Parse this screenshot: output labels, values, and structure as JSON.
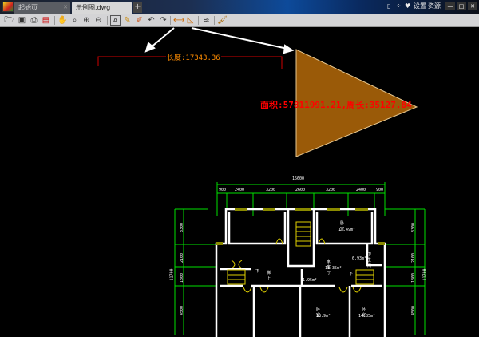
{
  "tabs": [
    {
      "label": "起始页"
    },
    {
      "label": "示例图.dwg"
    }
  ],
  "new_tab": "+",
  "title_right": {
    "settings": "设置",
    "resources": "资源"
  },
  "window_controls": {
    "minimize": "—",
    "maximize": "□",
    "close": "✕"
  },
  "toolbar": [
    "open",
    "save",
    "print",
    "export-pdf",
    "pan",
    "zoom-window",
    "zoom-in",
    "zoom-out",
    "text",
    "pencil",
    "markup",
    "undo",
    "redo",
    "measure-length",
    "measure-area",
    "layers",
    "paint"
  ],
  "measurements": {
    "length": "长度:17343.36",
    "area": "面积:57811991.21,周长:35127.84"
  },
  "colors": {
    "area_fill": "#9a5a08",
    "measure_red": "#d00000",
    "label_orange": "#ff8c00",
    "dim_green": "#00e000"
  },
  "plan": {
    "total_width": "15600",
    "top_dims": [
      "900",
      "2400",
      "3200",
      "2600",
      "3200",
      "2400",
      "900"
    ],
    "side_dims": [
      "3300",
      "2100",
      "1800",
      "4500"
    ],
    "total_height": "11700",
    "rooms": [
      {
        "name": "卧室",
        "area": "17.49m²"
      },
      {
        "name": "卫生间",
        "area": "6.93m²"
      },
      {
        "name": "家庭厅",
        "area": "11.35m²"
      },
      {
        "name": "卧室",
        "area": "18.9m²"
      },
      {
        "name": "卧室",
        "area": "14.85m²"
      },
      {
        "area": "1.95m²"
      }
    ],
    "stairs": {
      "up": "梯上",
      "down": "下",
      "down2": "下"
    }
  }
}
